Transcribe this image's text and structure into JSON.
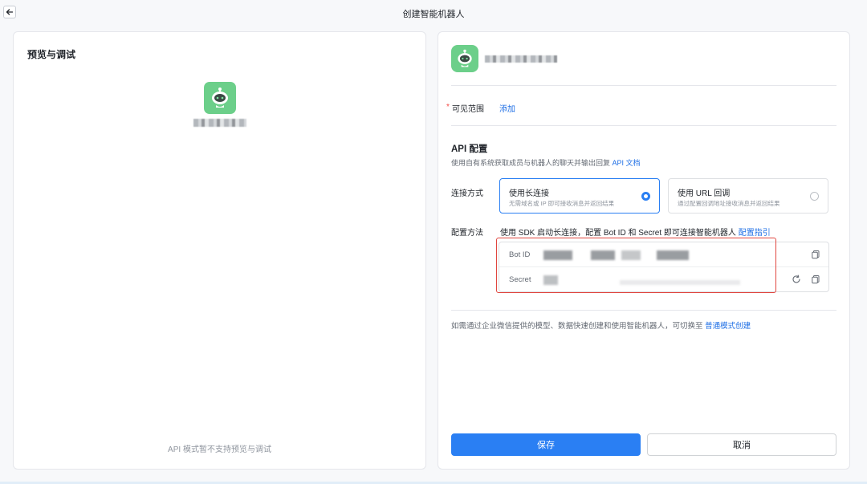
{
  "window": {
    "title": "创建智能机器人"
  },
  "preview": {
    "title": "预览与调试",
    "bot_name": "",
    "note": "API 模式暂不支持预览与调试"
  },
  "bot": {
    "name": ""
  },
  "visibility": {
    "label": "可见范围",
    "add_link": "添加"
  },
  "api_config": {
    "title": "API 配置",
    "description": "使用自有系统获取成员与机器人的聊天并输出回复",
    "doc_link": "API 文档",
    "connection_label": "连接方式",
    "options": [
      {
        "title": "使用长连接",
        "desc": "无需域名或 IP 即可接收消息并返回结果",
        "selected": true
      },
      {
        "title": "使用 URL 回调",
        "desc": "通过配置回调地址接收消息并返回结果",
        "selected": false
      }
    ],
    "method_label": "配置方法",
    "method_text": "使用 SDK 启动长连接，配置 Bot ID 和 Secret 即可连接智能机器人",
    "guide_link": "配置指引",
    "bot_id_label": "Bot ID",
    "secret_label": "Secret"
  },
  "switch": {
    "text": "如需通过企业微信提供的模型、数据快速创建和使用智能机器人，可切换至",
    "link": "普通模式创建"
  },
  "actions": {
    "save": "保存",
    "cancel": "取消"
  },
  "colors": {
    "accent": "#2a7ff3",
    "avatar": "#6ccf8a",
    "required": "#f54a45",
    "highlight": "#e0463f"
  }
}
